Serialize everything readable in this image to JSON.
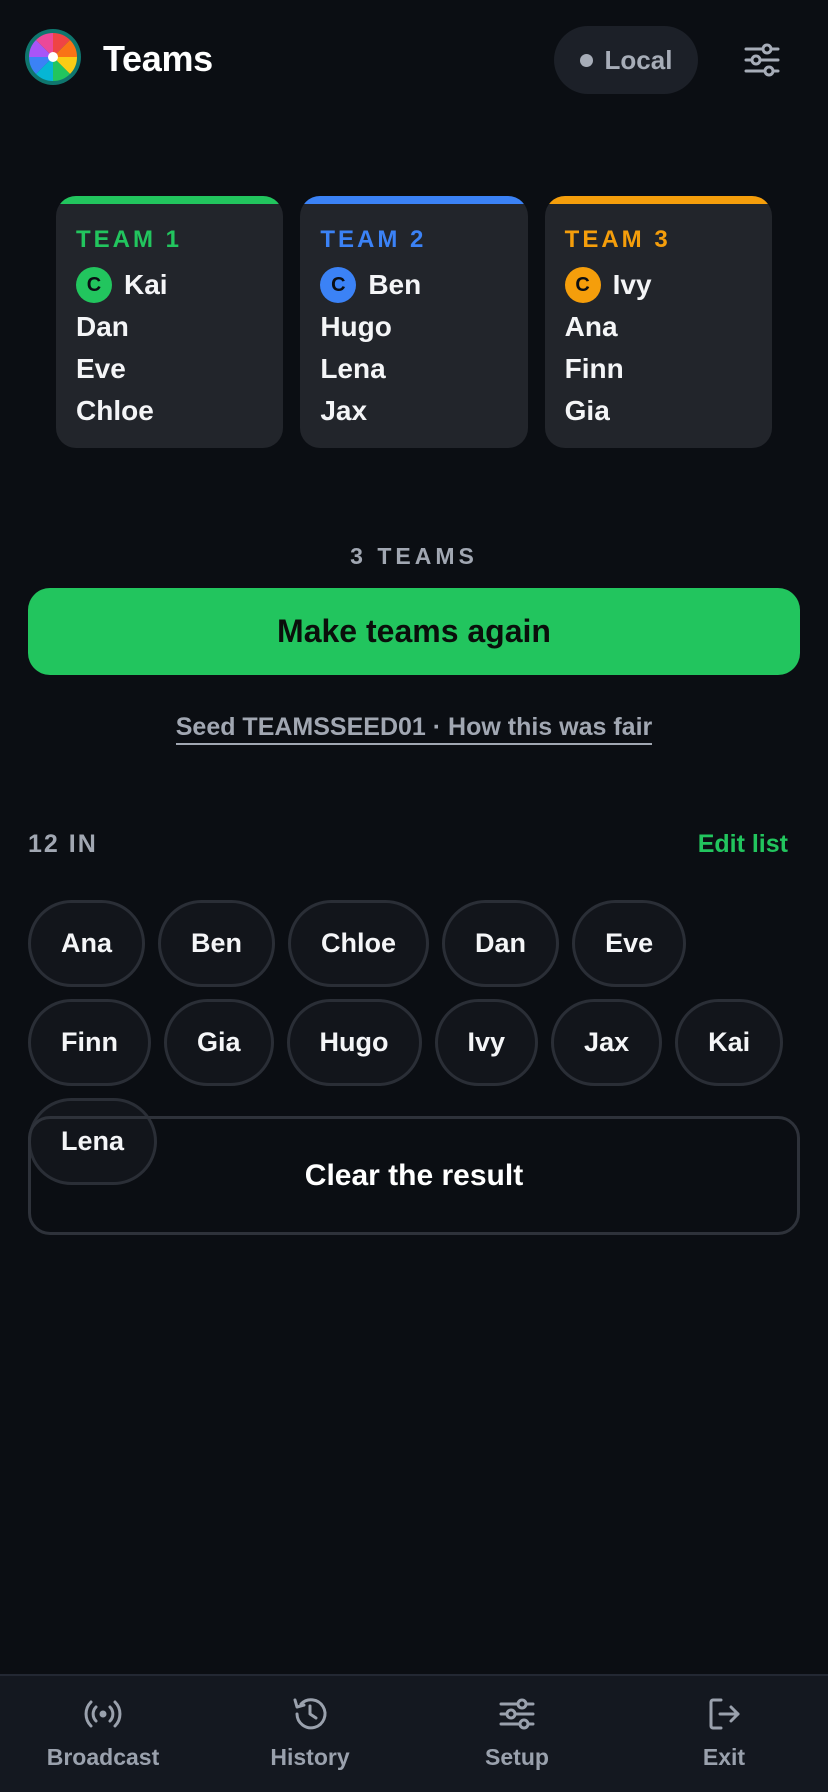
{
  "header": {
    "title": "Teams",
    "logo_icon": "spin-wheel-logo",
    "mode_label": "Local",
    "settings_icon": "sliders-icon"
  },
  "teams": [
    {
      "name": "TEAM 1",
      "color": "#22c55e",
      "captain_badge": "C",
      "captain": "Kai",
      "members": [
        "Dan",
        "Eve",
        "Chloe"
      ]
    },
    {
      "name": "TEAM 2",
      "color": "#3b82f6",
      "captain_badge": "C",
      "captain": "Ben",
      "members": [
        "Hugo",
        "Lena",
        "Jax"
      ]
    },
    {
      "name": "TEAM 3",
      "color": "#f59e0b",
      "captain_badge": "C",
      "captain": "Ivy",
      "members": [
        "Ana",
        "Finn",
        "Gia"
      ]
    }
  ],
  "summary": {
    "count_label": "3 TEAMS",
    "make_again_label": "Make teams again",
    "seed_link": "Seed TEAMSSEED01 · How this was fair"
  },
  "players": {
    "count_label": "12 IN",
    "edit_label": "Edit list",
    "names": [
      "Ana",
      "Ben",
      "Chloe",
      "Dan",
      "Eve",
      "Finn",
      "Gia",
      "Hugo",
      "Ivy",
      "Jax",
      "Kai",
      "Lena"
    ]
  },
  "clear_label": "Clear the result",
  "nav": [
    {
      "label": "Broadcast",
      "icon": "broadcast-icon"
    },
    {
      "label": "History",
      "icon": "history-icon"
    },
    {
      "label": "Setup",
      "icon": "sliders-icon"
    },
    {
      "label": "Exit",
      "icon": "exit-icon"
    }
  ],
  "colors": {
    "accent": "#22c55e",
    "background": "#0b0e13",
    "surface": "#22252b"
  }
}
